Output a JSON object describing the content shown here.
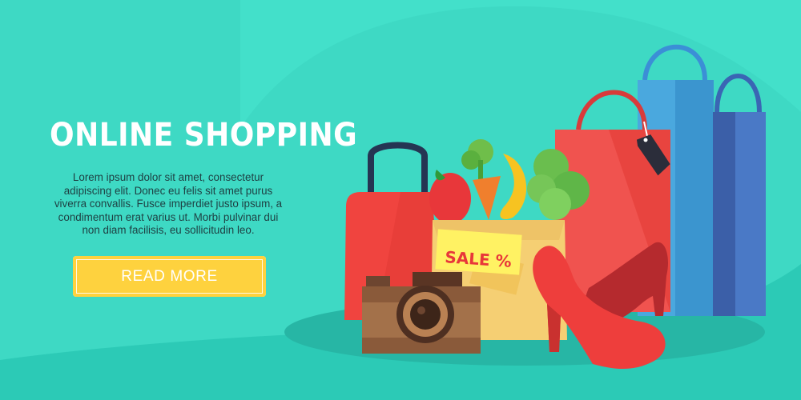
{
  "banner": {
    "title": "ONLINE SHOPPING",
    "description": "Lorem ipsum dolor sit amet, consectetur adipiscing elit. Donec eu felis sit amet purus viverra convallis. Fusce imperdiet justo ipsum, a condimentum erat varius ut. Morbi pulvinar dui non diam facilisis, eu sollicitudin leo.",
    "cta_label": "READ MORE",
    "sale_tag": "SALE %"
  },
  "colors": {
    "background": "#3ed9c4",
    "accent": "#fed23e",
    "sale_red": "#e8373a"
  },
  "illustration": {
    "items": [
      "handbag-icon",
      "camera-icon",
      "grocery-bag-icon",
      "high-heel-shoes-icon",
      "shopping-bags-icon",
      "price-tag-icon"
    ]
  }
}
